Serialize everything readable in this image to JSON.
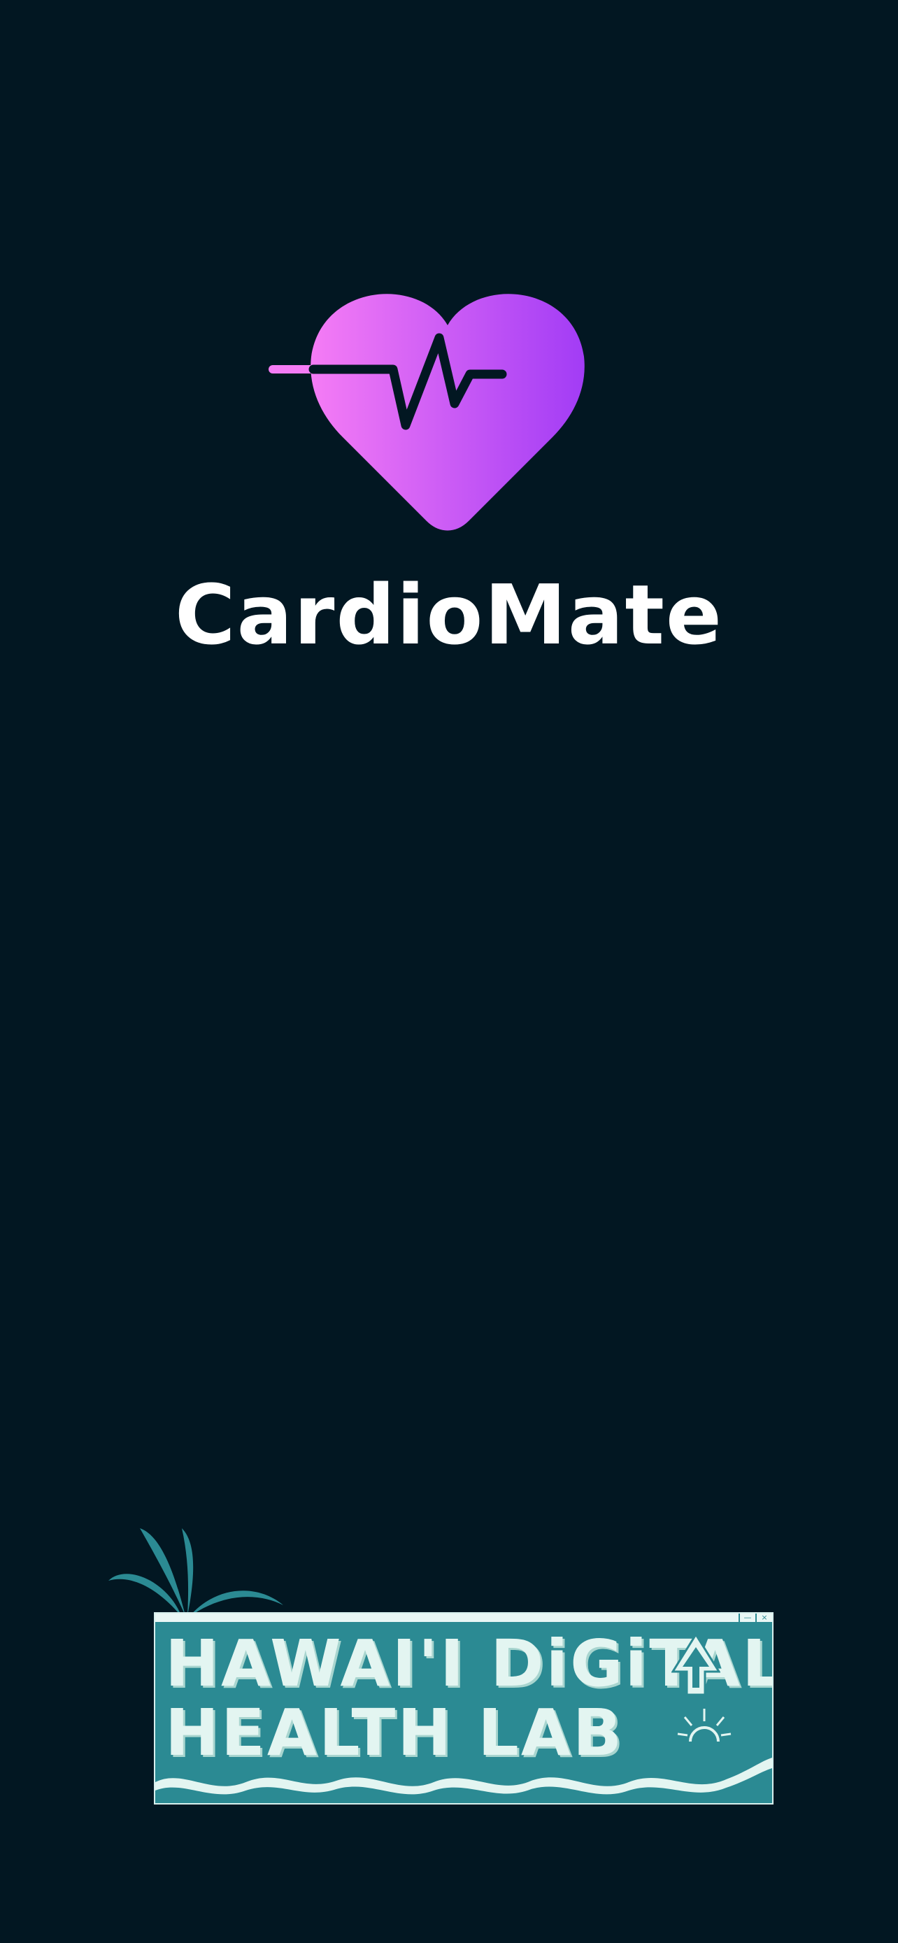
{
  "app": {
    "name": "CardioMate"
  },
  "heart_logo": {
    "icon": "heart-pulse-icon",
    "gradient_start": "#f57cf5",
    "gradient_end": "#a23cf5",
    "pulse_color": "#021722"
  },
  "lab_logo": {
    "line1": "HAWAI'I DiGiTAL",
    "line2": "HEALTH LAB",
    "icons": [
      "palm-leaves-icon",
      "cursor-arrow-icon",
      "sun-icon",
      "wave-icon"
    ],
    "window_color": "#2b8a93",
    "text_color": "#e3f5f1"
  },
  "colors": {
    "background": "#021722"
  }
}
